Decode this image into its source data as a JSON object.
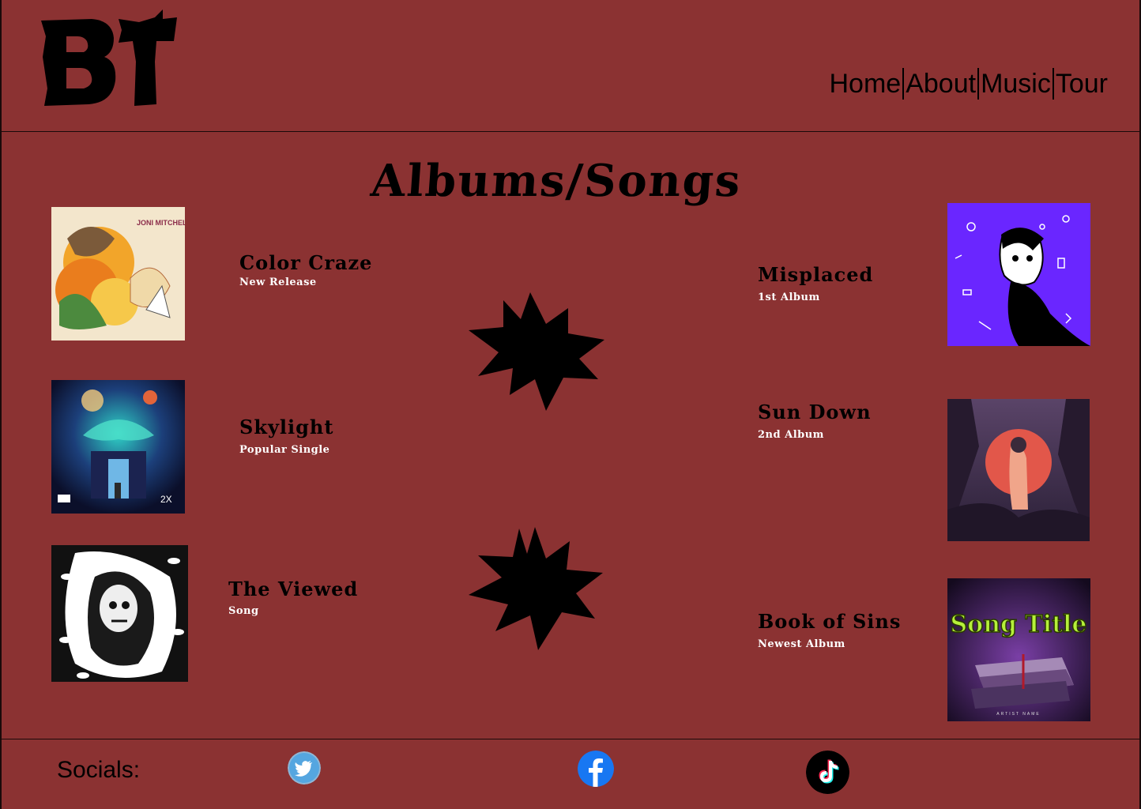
{
  "brand": {
    "logo_text": "BT"
  },
  "nav": {
    "items": [
      "Home",
      "About",
      "Music",
      "Tour"
    ]
  },
  "page_title": "Albums/Songs",
  "left_entries": [
    {
      "title": "Color Craze",
      "subtitle": "New Release",
      "cover": "joni-mitchell-cover",
      "cover_text": "JONI MITCHELL"
    },
    {
      "title": "Skylight",
      "subtitle": "Popular Single",
      "cover": "space-night-cover",
      "cover_text": "2X"
    },
    {
      "title": "The Viewed",
      "subtitle": "Song",
      "cover": "black-white-eyes-cover"
    }
  ],
  "right_entries": [
    {
      "title": "Misplaced",
      "subtitle": "1st Album",
      "cover": "purple-doodle-cover"
    },
    {
      "title": "Sun Down",
      "subtitle": "2nd Album",
      "cover": "sunset-forest-cover"
    },
    {
      "title": "Book of Sins",
      "subtitle": "Newest Album",
      "cover": "song-title-cover",
      "cover_text": "Song Title",
      "cover_small_text": "ARTIST NAME"
    }
  ],
  "footer": {
    "socials_label": "Socials:",
    "icons": [
      "twitter-icon",
      "facebook-icon",
      "tiktok-icon"
    ]
  },
  "colors": {
    "background": "#8b3232",
    "text": "#000000",
    "subtext": "#ffffff"
  }
}
